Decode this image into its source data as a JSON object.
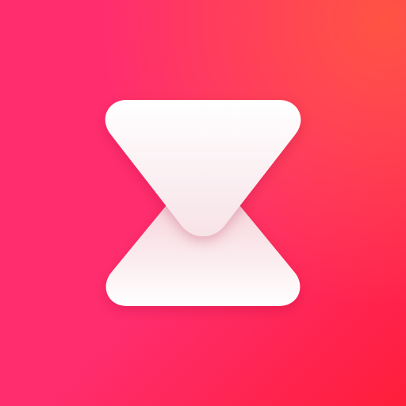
{
  "icon": {
    "name": "transfer-app-logo",
    "glyph": "hourglass-x-mark-icon",
    "colors": {
      "background_left": "#ff2d6e",
      "background_top_right": "#ff5a3c",
      "background_bottom": "#ff1e3a",
      "mark_light": "#ffffff",
      "mark_shadow": "#f3c9d2",
      "mark_tint": "#f7e3e8"
    }
  }
}
